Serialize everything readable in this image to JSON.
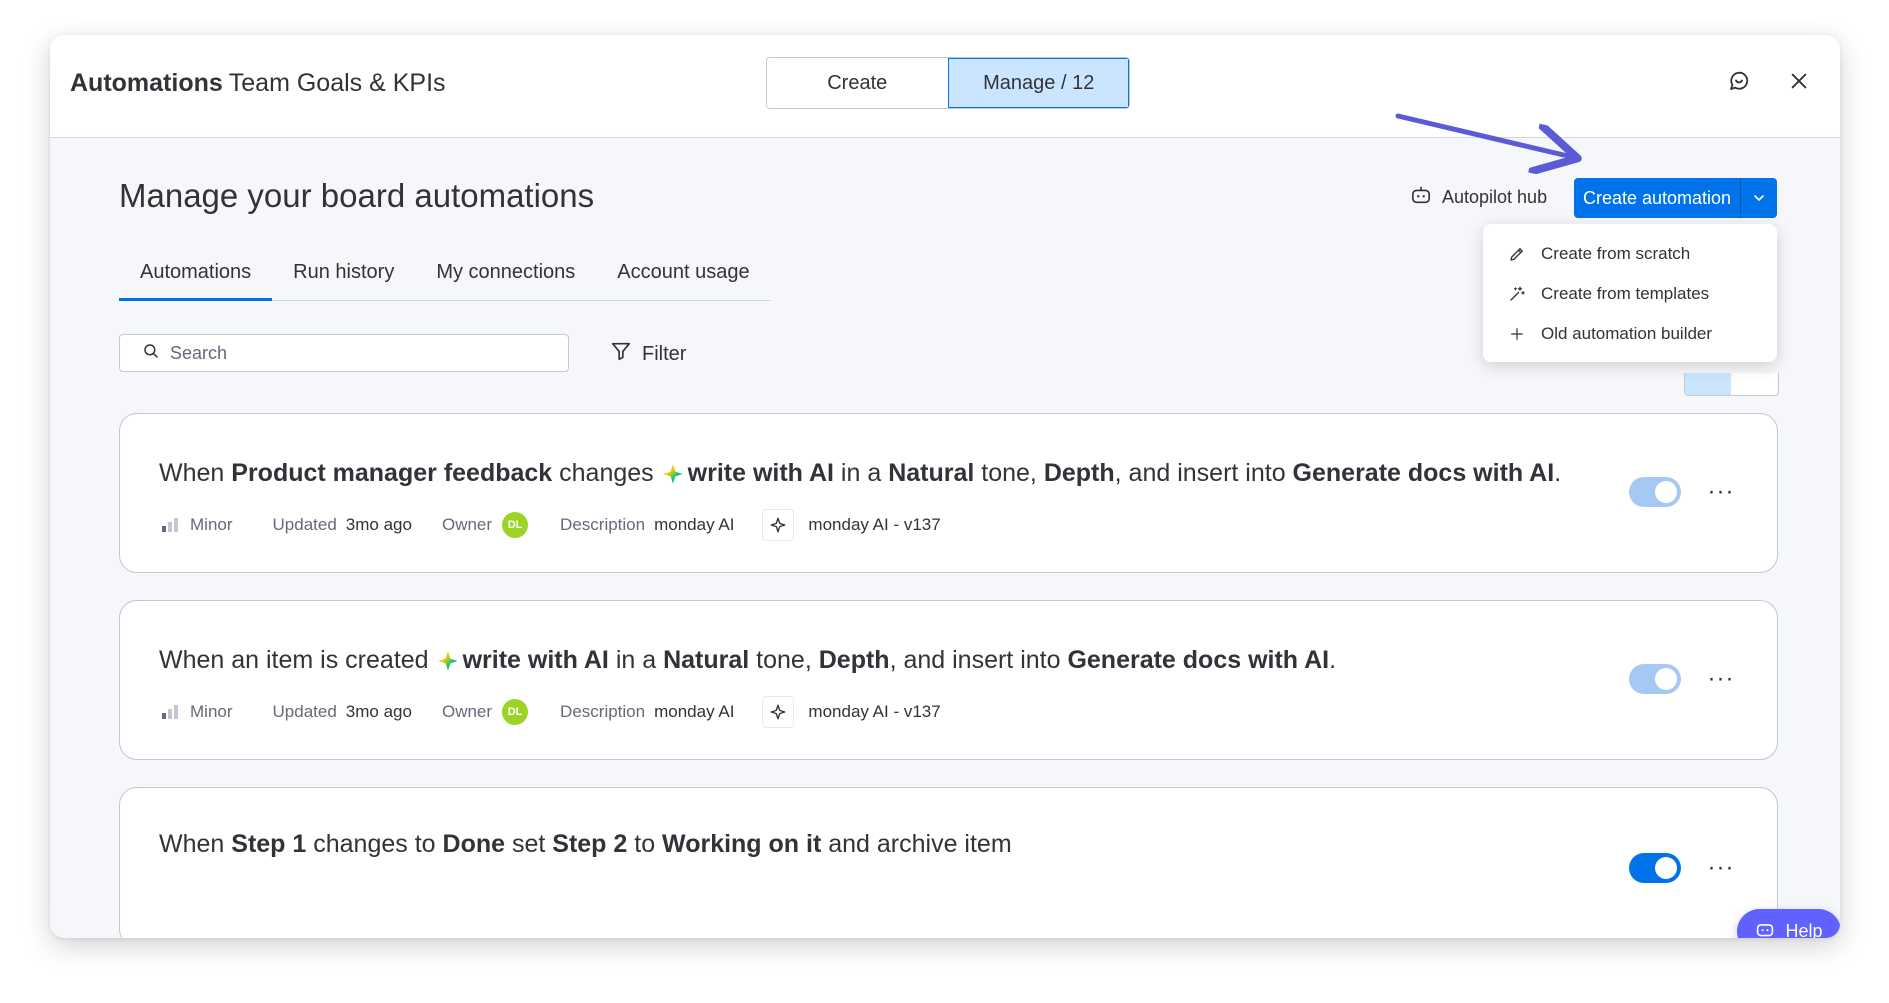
{
  "header": {
    "title_strong": "Automations",
    "title_board": "Team Goals & KPIs",
    "segment": [
      {
        "label": "Create",
        "active": false
      },
      {
        "label": "Manage / 12",
        "active": true
      }
    ]
  },
  "page": {
    "title": "Manage your board automations",
    "autopilot_label": "Autopilot hub",
    "create_button_label": "Create automation"
  },
  "tabs": [
    {
      "label": "Automations",
      "active": true
    },
    {
      "label": "Run history",
      "active": false
    },
    {
      "label": "My connections",
      "active": false
    },
    {
      "label": "Account usage",
      "active": false
    }
  ],
  "search": {
    "placeholder": "Search"
  },
  "filter": {
    "label": "Filter"
  },
  "dropdown": [
    {
      "label": "Create from scratch",
      "icon": "pencil-icon"
    },
    {
      "label": "Create from templates",
      "icon": "magic-wand-icon"
    },
    {
      "label": "Old automation builder",
      "icon": "plus-icon"
    }
  ],
  "cards": [
    {
      "sentence": [
        {
          "t": "When ",
          "b": false
        },
        {
          "t": "Product manager feedback",
          "b": true
        },
        {
          "t": " changes",
          "b": false
        },
        {
          "ai": true
        },
        {
          "t": "write with AI",
          "b": true
        },
        {
          "t": " in a ",
          "b": false
        },
        {
          "t": "Natural",
          "b": true
        },
        {
          "t": " tone, ",
          "b": false
        },
        {
          "t": "Depth",
          "b": true
        },
        {
          "t": ", and insert into ",
          "b": false
        },
        {
          "t": "Generate docs with AI",
          "b": true
        },
        {
          "t": ".",
          "b": false
        }
      ],
      "priority": "Minor",
      "updated_label": "Updated",
      "updated_value": "3mo ago",
      "owner_label": "Owner",
      "owner_initials": "DL",
      "description_label": "Description",
      "description_value": "monday AI",
      "version": "monday AI - v137",
      "enabled": true,
      "toggle_style": "light"
    },
    {
      "sentence": [
        {
          "t": "When an item is created",
          "b": false
        },
        {
          "ai": true
        },
        {
          "t": "write with AI",
          "b": true
        },
        {
          "t": " in a ",
          "b": false
        },
        {
          "t": "Natural",
          "b": true
        },
        {
          "t": " tone, ",
          "b": false
        },
        {
          "t": "Depth",
          "b": true
        },
        {
          "t": ", and insert into ",
          "b": false
        },
        {
          "t": "Generate docs with AI",
          "b": true
        },
        {
          "t": ".",
          "b": false
        }
      ],
      "priority": "Minor",
      "updated_label": "Updated",
      "updated_value": "3mo ago",
      "owner_label": "Owner",
      "owner_initials": "DL",
      "description_label": "Description",
      "description_value": "monday AI",
      "version": "monday AI - v137",
      "enabled": true,
      "toggle_style": "light"
    },
    {
      "sentence": [
        {
          "t": "When ",
          "b": false
        },
        {
          "t": "Step 1",
          "b": true
        },
        {
          "t": " changes to ",
          "b": false
        },
        {
          "t": "Done",
          "b": true
        },
        {
          "t": " set ",
          "b": false
        },
        {
          "t": "Step 2",
          "b": true
        },
        {
          "t": " to ",
          "b": false
        },
        {
          "t": "Working on it",
          "b": true
        },
        {
          "t": " and archive item",
          "b": false
        }
      ],
      "enabled": true,
      "toggle_style": "dark"
    }
  ],
  "help": {
    "label": "Help"
  },
  "colors": {
    "primary": "#0073ea",
    "help": "#6161ff",
    "arrow": "#5b5bd6",
    "avatar": "#9cd326"
  }
}
